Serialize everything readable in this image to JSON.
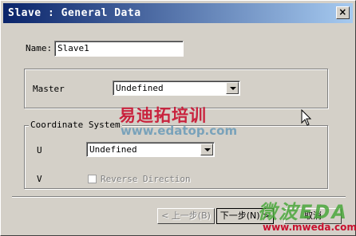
{
  "window": {
    "title": "Slave : General Data",
    "close_symbol": "×"
  },
  "name_field": {
    "label": "Name:",
    "value": "Slave1"
  },
  "master_group": {
    "label": "Master",
    "selected": "Undefined"
  },
  "coordinate_group": {
    "title": "Coordinate System",
    "u_label": "U",
    "u_selected": "Undefined",
    "v_label": "V",
    "reverse_label": "Reverse Direction",
    "reverse_checked": false
  },
  "buttons": {
    "back": "< 上一步(B)",
    "next": "下一步(N) >",
    "cancel": "取消"
  },
  "watermarks": {
    "edatop_cn": "易迪拓培训",
    "edatop_url": "www.edatop.com",
    "mweda_logo": "微波EDA",
    "mweda_url": "www.mweda.com"
  },
  "colors": {
    "title_start": "#0a246a",
    "title_end": "#a6caf0",
    "face": "#d4d0c8"
  }
}
